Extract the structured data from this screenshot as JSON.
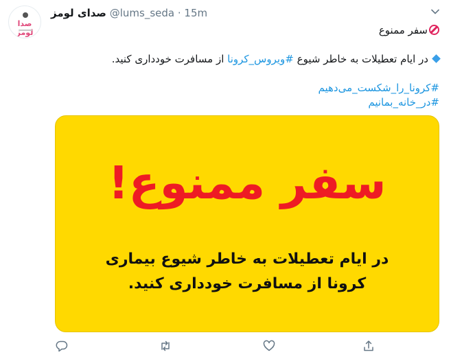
{
  "tweet": {
    "display_name": "صدای لومز",
    "handle": "@lums_seda",
    "separator": "·",
    "time": "15m",
    "avatar_logo_text": "صدا لومز",
    "line1_text": "سفر ممنوع",
    "line2_before": "در ایام تعطیلات به خاطر شیوع ",
    "line2_hashtag": "#ویروس_کرونا",
    "line2_after": " از مسافرت خودداری کنید.",
    "hashtag_1": "#کرونا_را_شکست_می‌دهیم",
    "hashtag_2": "#در_خانه_بمانیم"
  },
  "media": {
    "headline": "سفر ممنوع!",
    "subtitle_line1": "در ایام تعطیلات به خاطر شیوع بیماری",
    "subtitle_line2": "کرونا از مسافرت خودداری کنید.",
    "background_color": "#ffd900",
    "headline_color": "#ee1b24"
  },
  "icons": {
    "no_entry": "no-entry-icon",
    "diamond": "small-blue-diamond-icon",
    "reply": "reply-icon",
    "retweet": "retweet-icon",
    "like": "heart-icon",
    "share": "share-icon",
    "menu": "chevron-down-icon"
  },
  "colors": {
    "link": "#1b95e0",
    "secondary_text": "#657786",
    "primary_text": "#14171a"
  }
}
